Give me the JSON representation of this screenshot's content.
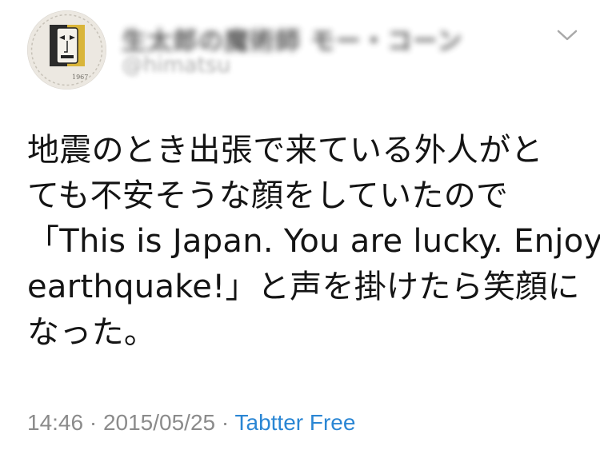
{
  "tweet": {
    "display_name": "生太郎の魔術師 モー・コーン",
    "handle": "@himatsu",
    "avatar": {
      "icon": "picasso-face-plate-avatar",
      "year": "1967"
    },
    "menu_icon": "chevron-down-icon",
    "text_lines": [
      "地震のとき出張で来ている外人がと",
      "ても不安そうな顔をしていたので",
      "「This is Japan. You are lucky. Enjoy",
      "earthquake!」と声を掛けたら笑顔に",
      "なった。"
    ],
    "time": "14:46",
    "date": "2015/05/25",
    "separator": "·",
    "app": "Tabtter Free",
    "colors": {
      "text": "#141414",
      "meta": "#8b8b8b",
      "app_link": "#2a86d4"
    }
  }
}
